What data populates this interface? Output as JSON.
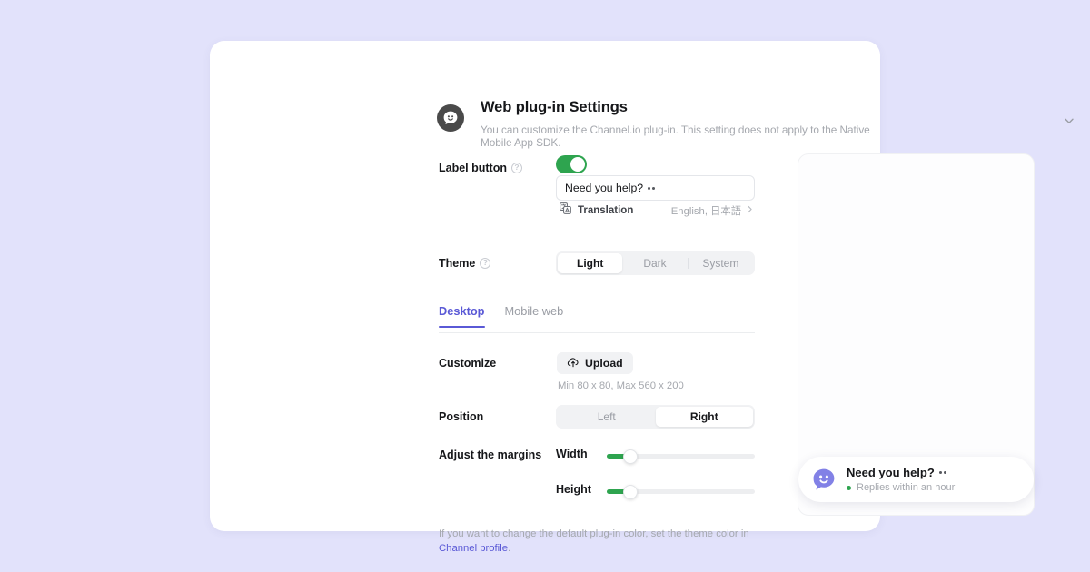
{
  "header": {
    "title": "Web plug-in Settings",
    "subtitle": "You can customize the Channel.io plug-in. This setting does not apply to the Native Mobile App SDK.",
    "logo_icon": "channel-talk-logo-icon",
    "collapse_icon": "chevron-down-icon"
  },
  "label_button": {
    "label": "Label button",
    "help_icon": "help-circle-icon",
    "toggle_on": true,
    "input_value": "Need you help?",
    "input_placeholder": "Need you help?",
    "translation": {
      "icon": "translate-icon",
      "label": "Translation",
      "value": "English, 日本語",
      "chevron": "chevron-right-icon"
    }
  },
  "theme": {
    "label": "Theme",
    "help_icon": "help-circle-icon",
    "options": [
      "Light",
      "Dark",
      "System"
    ],
    "selected": "Light"
  },
  "tabs": {
    "items": [
      "Desktop",
      "Mobile web"
    ],
    "active": "Desktop",
    "active_color": "#5a59d6"
  },
  "customize": {
    "label": "Customize",
    "upload_label": "Upload",
    "upload_icon": "cloud-upload-icon",
    "hint": "Min 80 x 80, Max 560 x 200"
  },
  "position": {
    "label": "Position",
    "options": [
      "Left",
      "Right"
    ],
    "selected": "Right"
  },
  "margins": {
    "label": "Adjust the margins",
    "sliders": [
      {
        "name": "Width",
        "percent": 16
      },
      {
        "name": "Height",
        "percent": 16
      }
    ],
    "track_color": "#edeef0",
    "fill_color": "#2ea44f"
  },
  "footer": {
    "text": "If you want to change the default plug-in color, set the theme color in ",
    "link": "Channel profile",
    "period": "."
  },
  "preview": {
    "chat": {
      "avatar_icon": "chat-bubble-face-icon",
      "title": "Need you help?",
      "status": "Replies within an hour",
      "status_dot_color": "#2ea44f"
    }
  },
  "colors": {
    "page_background": "#e2e2fb",
    "card_background": "#ffffff",
    "accent_purple": "#5a59d6",
    "toggle_green": "#2ea44f"
  }
}
